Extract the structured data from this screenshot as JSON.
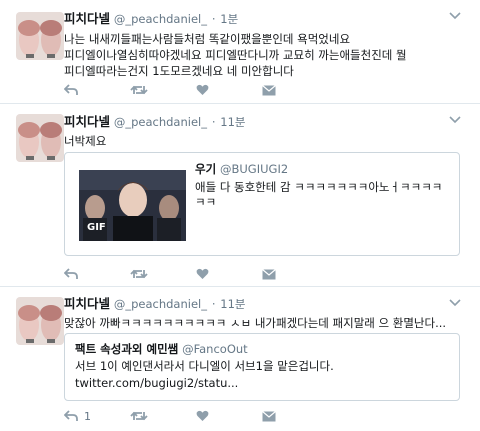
{
  "tweets": [
    {
      "fullname": "피치다넬",
      "screenname": "@_peachdaniel_",
      "dot": "·",
      "time": "1분",
      "text": "나는 내새끼들패는사람들처럼 똑같이팼을뿐인데 욕먹었네요 피디엘이나열심히따야겠네요 피디엘딴다니까 교묘히 까는애들천진데 뭘 피디엘따라는건지 1도모르겠네요 네 미안합니다"
    },
    {
      "fullname": "피치다넬",
      "screenname": "@_peachdaniel_",
      "dot": "·",
      "time": "11분",
      "text": "너박제요",
      "quote": {
        "name": "우기",
        "handle": "@BUGIUGI2",
        "text": "애들 다 동호한테 감 ㅋㅋㅋㅋㅋㅋㅋ아노ㅓㅋㅋㅋㅋㅋㅋ",
        "media_badge": "GIF"
      }
    },
    {
      "fullname": "피치다넬",
      "screenname": "@_peachdaniel_",
      "dot": "·",
      "time": "11분",
      "text": "맞잖아 까빠ㅋㅋㅋㅋㅋㅋㅋㅋㅋㅋ ㅅㅂ 내가패겠다는데 패지말래 으 환멸난다...",
      "retweet_count": "1",
      "quote": {
        "name": "팩트 속성과외 예민쌤",
        "handle": "@FancoOut",
        "text": "서브 1이 예인댄서라서 다니엘이 서브1을 맡은겁니다.",
        "link": "twitter.com/bugiugi2/statu..."
      }
    }
  ],
  "colors": {
    "action_icon": "#8f9fab",
    "secondary_text": "#657786",
    "border": "#e1e8ed"
  },
  "icons": {
    "reply": "reply-icon",
    "retweet": "retweet-icon",
    "like": "heart-icon",
    "message": "envelope-icon",
    "more": "caret-down-icon"
  }
}
